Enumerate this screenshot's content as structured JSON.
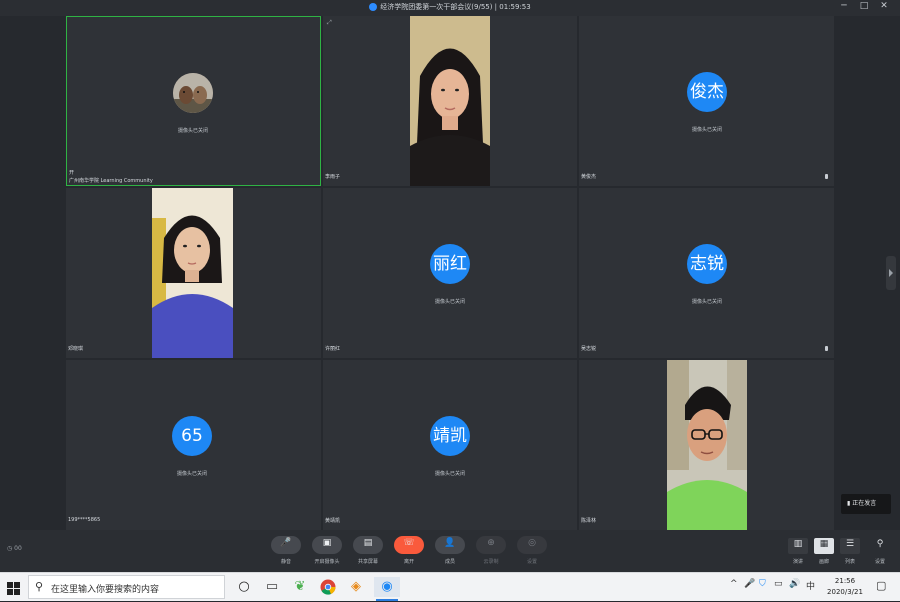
{
  "window": {
    "title": "经济学院团委第一次干部会议(9/55) | 01:59:53",
    "controls": [
      "─",
      "□",
      "✕"
    ]
  },
  "tiles": [
    {
      "name": "开",
      "org": "广州南华学院 Learning Community",
      "camera_text": "摄像头已关闭",
      "avatar": "photo"
    },
    {
      "name": "李雨子",
      "avatar": "video"
    },
    {
      "name": "黄俊杰",
      "camera_text": "摄像头已关闭",
      "avatar_text": "俊杰"
    },
    {
      "name": "邓晓琪",
      "avatar": "video"
    },
    {
      "name": "许丽红",
      "camera_text": "摄像头已关闭",
      "avatar_text": "丽红"
    },
    {
      "name": "吴志锐",
      "camera_text": "摄像头已关闭",
      "avatar_text": "志锐"
    },
    {
      "name": "199****5865",
      "camera_text": "摄像头已关闭",
      "avatar_text": "65"
    },
    {
      "name": "黄靖凯",
      "camera_text": "摄像头已关闭",
      "avatar_text": "靖凯"
    },
    {
      "name": "陈泽林",
      "avatar": "video"
    }
  ],
  "speaking_badge": "正在发言",
  "toolbar": {
    "left_text": "◷ 00",
    "buttons": [
      {
        "icon": "microphone-icon",
        "glyph": "🎤",
        "label": "静音"
      },
      {
        "icon": "video-camera-icon",
        "glyph": "▣",
        "label": "开启摄像头"
      },
      {
        "icon": "share-screen-icon",
        "glyph": "▤",
        "label": "共享屏幕"
      },
      {
        "icon": "leave-icon",
        "glyph": "☏",
        "label": "离开"
      },
      {
        "icon": "participants-icon",
        "glyph": "👤",
        "label": "成员"
      },
      {
        "icon": "record-icon",
        "glyph": "⊕",
        "label": "云录制"
      },
      {
        "icon": "settings-icon",
        "glyph": "◎",
        "label": "设置"
      }
    ],
    "right_buttons": [
      {
        "icon": "speaker-view-icon",
        "glyph": "▥",
        "label": "演讲"
      },
      {
        "icon": "gallery-view-icon",
        "glyph": "▦",
        "label": "画廊"
      },
      {
        "icon": "list-view-icon",
        "glyph": "☰",
        "label": "列表"
      },
      {
        "icon": "location-icon",
        "glyph": "⚲",
        "label": "设置"
      }
    ]
  },
  "taskbar": {
    "search_placeholder": "在这里输入你要搜索的内容",
    "clock_time": "21:56",
    "clock_date": "2020/3/21",
    "ime": "中",
    "tray_icons": [
      "^",
      "🎤",
      "⛉",
      "▭",
      "🔊"
    ]
  },
  "colors": {
    "avatar_blue": "#1e88f5",
    "active_border": "#2fb344",
    "leave_button": "#fa5a3c",
    "meeting_bg": "#26292e",
    "tile_bg": "#2f3237"
  }
}
